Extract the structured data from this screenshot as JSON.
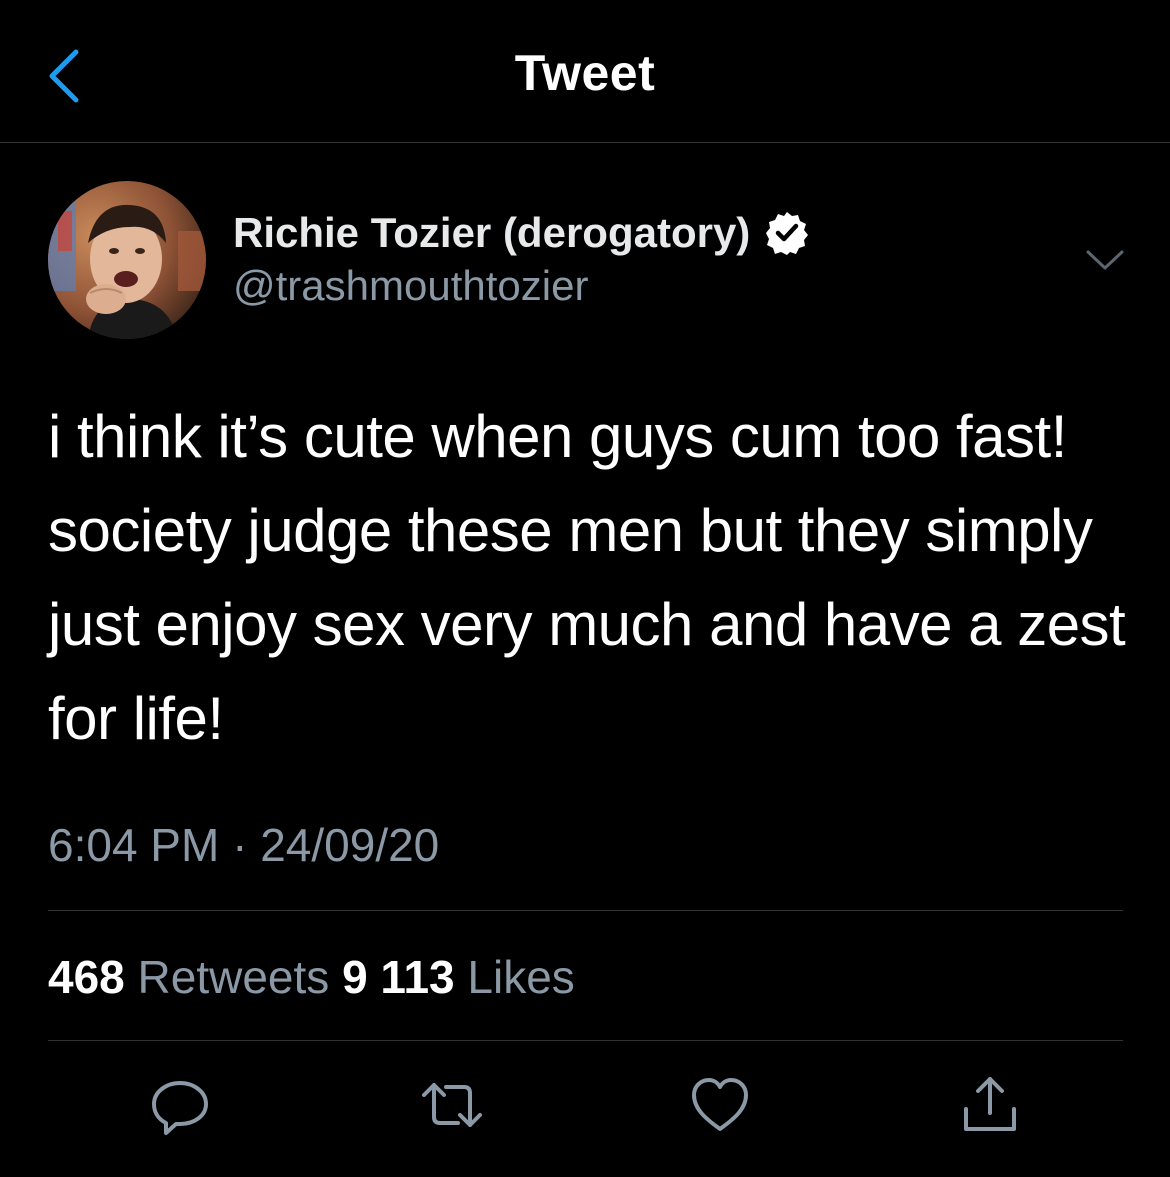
{
  "header": {
    "title": "Tweet",
    "back_icon": "chevron-left-icon"
  },
  "colors": {
    "background": "#000000",
    "accent": "#1d9bf0",
    "secondary_text": "#8b98a5",
    "divider": "#2f3336"
  },
  "author": {
    "display_name": "Richie Tozier (derogatory)",
    "handle": "@trashmouthtozier",
    "verified": true,
    "avatar_icon": "profile-photo"
  },
  "tweet": {
    "text": "i think it’s cute when guys cum too fast! society judge these men but they simply just enjoy sex very much and have a zest for life!",
    "time": "6:04 PM",
    "separator": "·",
    "date": "24/09/20"
  },
  "stats": {
    "retweets_count": "468",
    "retweets_label": "Retweets",
    "likes_count": "9 113",
    "likes_label": "Likes"
  },
  "actions": [
    {
      "icon": "reply-icon"
    },
    {
      "icon": "retweet-icon"
    },
    {
      "icon": "like-icon"
    },
    {
      "icon": "share-icon"
    }
  ]
}
